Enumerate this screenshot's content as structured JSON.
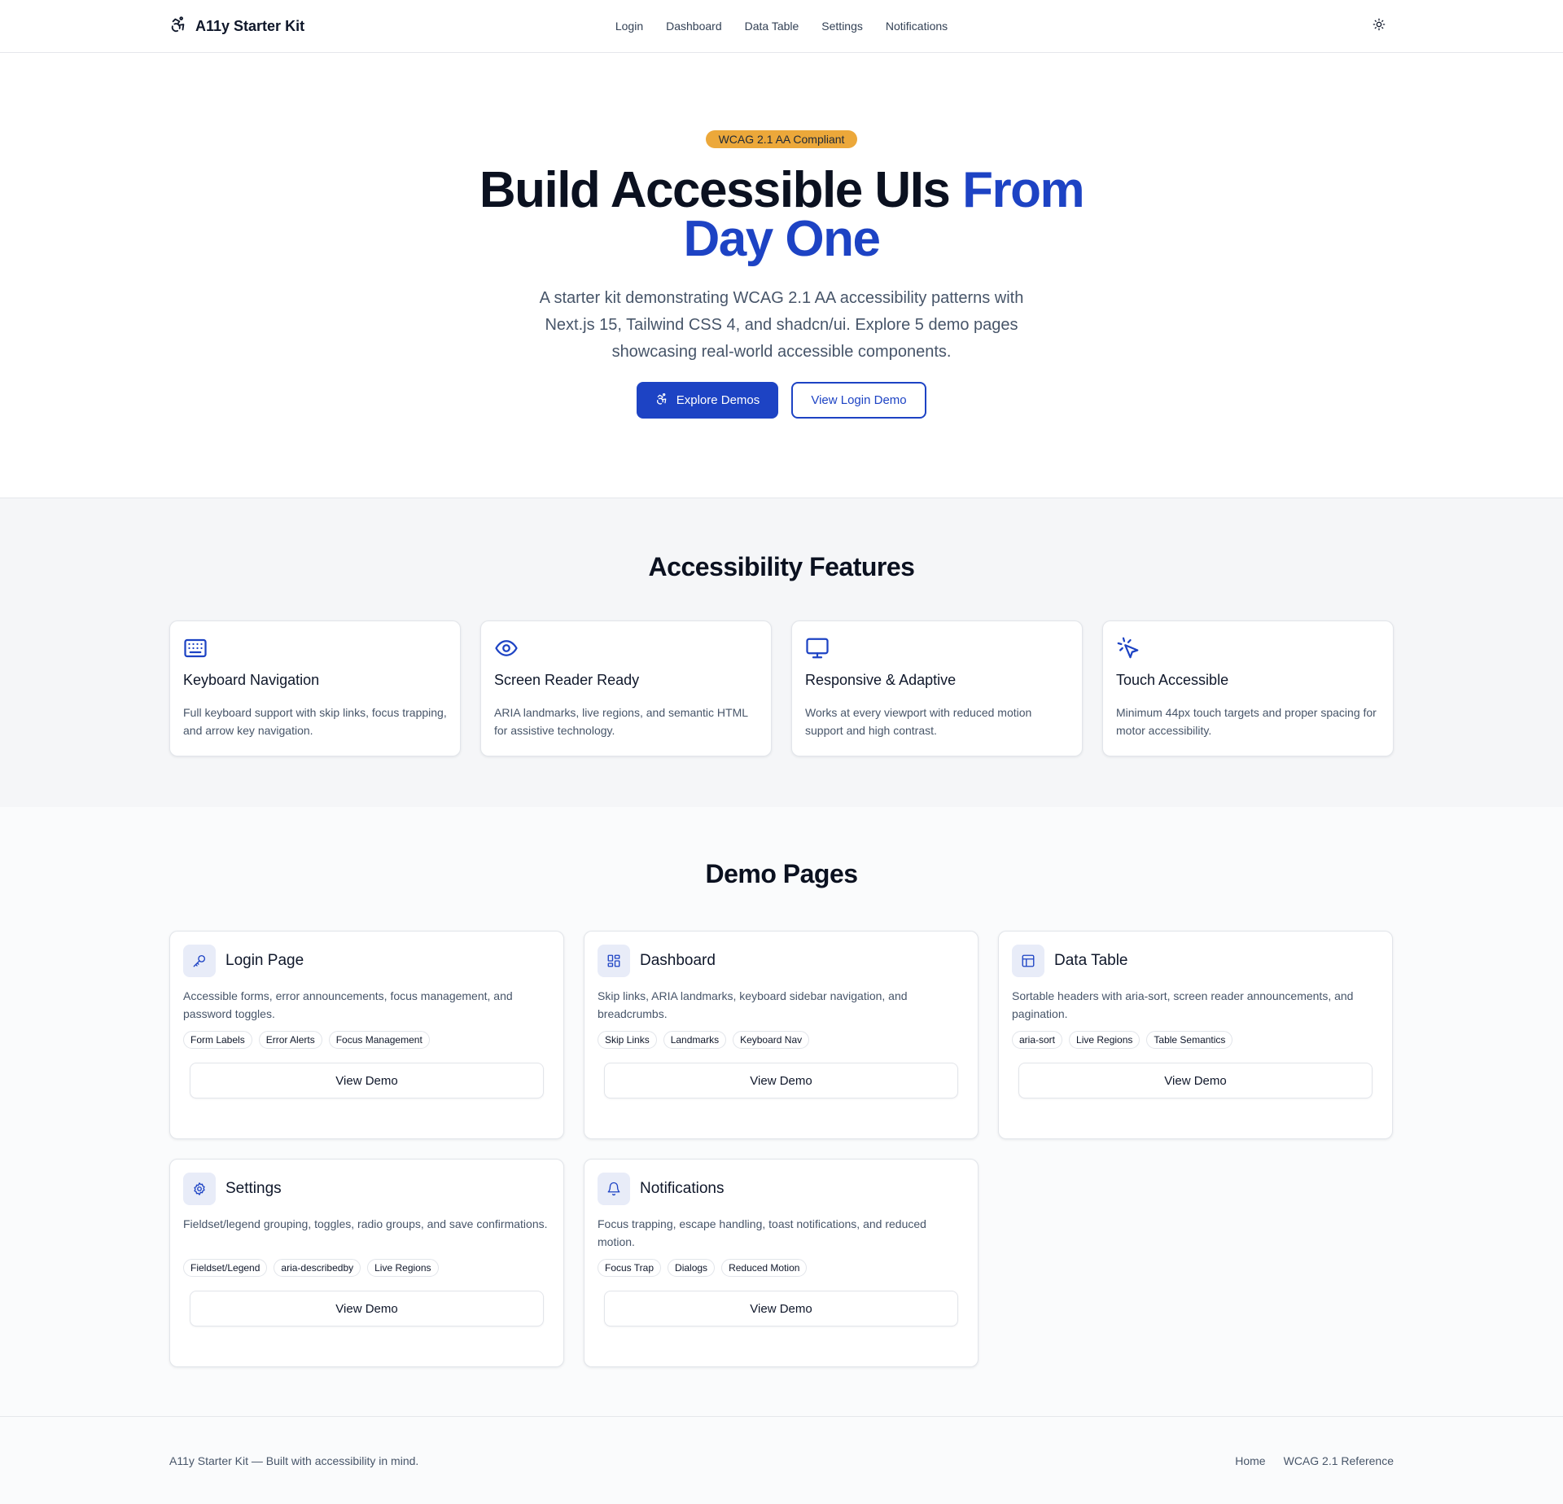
{
  "header": {
    "brand": "A11y Starter Kit",
    "nav": [
      "Login",
      "Dashboard",
      "Data Table",
      "Settings",
      "Notifications"
    ]
  },
  "hero": {
    "badge": "WCAG 2.1 AA Compliant",
    "title_main": "Build Accessible UIs",
    "title_accent": "From Day One",
    "subtitle": "A starter kit demonstrating WCAG 2.1 AA accessibility patterns with Next.js 15, Tailwind CSS 4, and shadcn/ui. Explore 5 demo pages showcasing real-world accessible components.",
    "primary_button": "Explore Demos",
    "secondary_button": "View Login Demo"
  },
  "features": {
    "title": "Accessibility Features",
    "items": [
      {
        "icon": "keyboard-icon",
        "title": "Keyboard Navigation",
        "desc": "Full keyboard support with skip links, focus trapping, and arrow key navigation."
      },
      {
        "icon": "eye-icon",
        "title": "Screen Reader Ready",
        "desc": "ARIA landmarks, live regions, and semantic HTML for assistive technology."
      },
      {
        "icon": "monitor-icon",
        "title": "Responsive & Adaptive",
        "desc": "Works at every viewport with reduced motion support and high contrast."
      },
      {
        "icon": "pointer-click-icon",
        "title": "Touch Accessible",
        "desc": "Minimum 44px touch targets and proper spacing for motor accessibility."
      }
    ]
  },
  "demos": {
    "title": "Demo Pages",
    "button_label": "View Demo",
    "items": [
      {
        "icon": "key-icon",
        "title": "Login Page",
        "desc": "Accessible forms, error announcements, focus management, and password toggles.",
        "tags": [
          "Form Labels",
          "Error Alerts",
          "Focus Management"
        ]
      },
      {
        "icon": "dashboard-grid-icon",
        "title": "Dashboard",
        "desc": "Skip links, ARIA landmarks, keyboard sidebar navigation, and breadcrumbs.",
        "tags": [
          "Skip Links",
          "Landmarks",
          "Keyboard Nav"
        ]
      },
      {
        "icon": "table-icon",
        "title": "Data Table",
        "desc": "Sortable headers with aria-sort, screen reader announcements, and pagination.",
        "tags": [
          "aria-sort",
          "Live Regions",
          "Table Semantics"
        ]
      },
      {
        "icon": "gear-icon",
        "title": "Settings",
        "desc": "Fieldset/legend grouping, toggles, radio groups, and save confirmations.",
        "tags": [
          "Fieldset/Legend",
          "aria-describedby",
          "Live Regions"
        ]
      },
      {
        "icon": "bell-icon",
        "title": "Notifications",
        "desc": "Focus trapping, escape handling, toast notifications, and reduced motion.",
        "tags": [
          "Focus Trap",
          "Dialogs",
          "Reduced Motion"
        ]
      }
    ]
  },
  "footer": {
    "text": "A11y Starter Kit — Built with accessibility in mind.",
    "links": [
      "Home",
      "WCAG 2.1 Reference"
    ]
  },
  "colors": {
    "accent": "#1d43c4",
    "badge": "#eca83a"
  }
}
